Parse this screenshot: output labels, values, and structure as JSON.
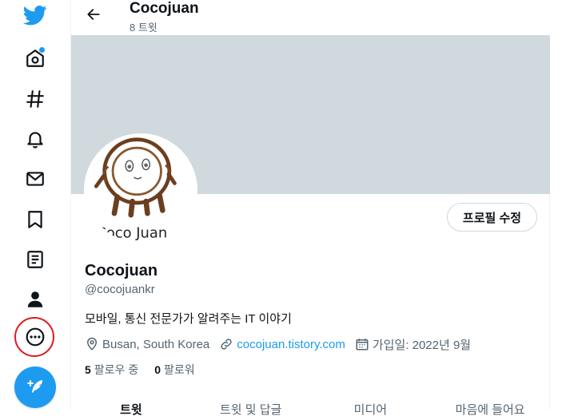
{
  "header": {
    "title": "Cocojuan",
    "subtitle": "8 트윗"
  },
  "profile": {
    "name": "Cocojuan",
    "handle": "@cocojuankr",
    "bio": "모바일, 통신 전문가가 알려주는 IT 이야기",
    "location": "Busan, South Korea",
    "website": "cocojuan.tistory.com",
    "joined": "가입일: 2022년 9월",
    "following_count": "5",
    "following_label": "팔로우 중",
    "followers_count": "0",
    "followers_label": "팔로워",
    "edit_button": "프로필 수정",
    "avatar_signature": "Coco Juan"
  },
  "tabs": [
    "트윗",
    "트윗 및 답글",
    "미디어",
    "마음에 들어요"
  ],
  "sidebar": {
    "icons": [
      "twitter-logo-icon",
      "home-icon",
      "explore-hashtag-icon",
      "notifications-bell-icon",
      "messages-envelope-icon",
      "bookmark-icon",
      "lists-icon",
      "profile-person-icon",
      "more-icon",
      "compose-tweet-icon"
    ]
  },
  "colors": {
    "accent": "#1d9bf0",
    "banner": "#cfd9de",
    "highlight_ring": "#e0191f"
  }
}
